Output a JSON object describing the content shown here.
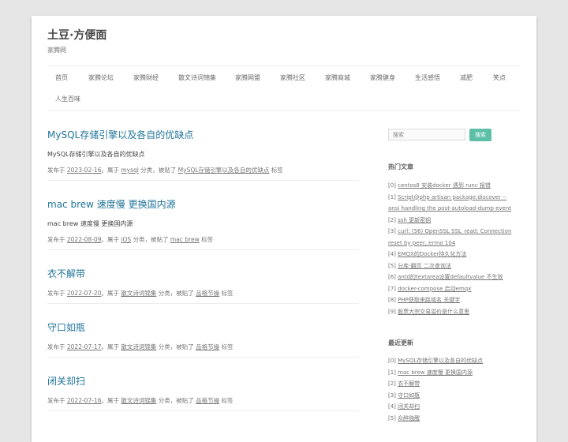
{
  "site": {
    "title": "土豆·方便面",
    "description": "家腾网"
  },
  "nav": [
    "首页",
    "家腾论坛",
    "家腾财经",
    "散文诗词锦集",
    "家腾网盟",
    "家腾社区",
    "家腾商城",
    "家腾健身",
    "生活感悟",
    "减肥",
    "笑点",
    "人生百味"
  ],
  "posts": [
    {
      "title": "MySQL存储引擎以及各自的优缺点",
      "excerpt": "MySQL存储引擎以及各自的优缺点",
      "meta_pre": "发布于 ",
      "date": "2023-02-16",
      "mid1": "。属于 ",
      "category": "mysql",
      "mid2": " 分类，被贴了 ",
      "tag": "MySQL存储引擎以及各自的优缺点",
      "post": " 标签"
    },
    {
      "title": "mac brew 速度慢 更换国内源",
      "excerpt": "mac brew 速度慢 更换国内源",
      "meta_pre": "发布于 ",
      "date": "2022-08-09",
      "mid1": "。属于 ",
      "category": "iOS",
      "mid2": " 分类，被贴了 ",
      "tag": "mac brew",
      "post": " 标签"
    },
    {
      "title": "衣不解带",
      "excerpt": "",
      "meta_pre": "发布于 ",
      "date": "2022-07-20",
      "mid1": "。属于 ",
      "category": "散文诗词锦集",
      "mid2": " 分类，被贴了 ",
      "tag": "品格节操",
      "post": " 标签"
    },
    {
      "title": "守口如瓶",
      "excerpt": "",
      "meta_pre": "发布于 ",
      "date": "2022-07-17",
      "mid1": "。属于 ",
      "category": "散文诗词锦集",
      "mid2": " 分类，被贴了 ",
      "tag": "品格节操",
      "post": " 标签"
    },
    {
      "title": "闭关却扫",
      "excerpt": "",
      "meta_pre": "发布于 ",
      "date": "2022-07-16",
      "mid1": "。属于 ",
      "category": "散文诗词锦集",
      "mid2": " 分类，被贴了 ",
      "tag": "品格节操",
      "post": " 标签"
    }
  ],
  "search": {
    "placeholder": "搜索",
    "button": "搜索"
  },
  "hot": {
    "title": "热门文章",
    "items": [
      {
        "idx": "[0] ",
        "text": "centos8 安装docker 遇到 runc 报错"
      },
      {
        "idx": "[1] ",
        "text": "Script@php artisan package:discover --ansi handling the post-autoload-dump event"
      },
      {
        "idx": "[2] ",
        "text": "ssh 更新密钥"
      },
      {
        "idx": "[3] ",
        "text": "curl: (56) OpenSSL SSL_read: Connection reset by peer, errno 104"
      },
      {
        "idx": "[4] ",
        "text": "EMQX的Docker持久化方法"
      },
      {
        "idx": "[5] ",
        "text": "分库-翻页 二次查询法"
      },
      {
        "idx": "[6] ",
        "text": "antd的textarea设置defaultvalue 不生效"
      },
      {
        "idx": "[7] ",
        "text": "docker-compose 启动emqx"
      },
      {
        "idx": "[8] ",
        "text": "PHP获取来路域名 关键字"
      },
      {
        "idx": "[9] ",
        "text": "股票大宗交易溢价是什么意思"
      }
    ]
  },
  "recent": {
    "title": "最近更新",
    "items": [
      {
        "idx": "[0] ",
        "text": "MySQL存储引擎以及各自的优缺点"
      },
      {
        "idx": "[1] ",
        "text": "mac brew 速度慢 更换国内源"
      },
      {
        "idx": "[2] ",
        "text": "衣不解带"
      },
      {
        "idx": "[3] ",
        "text": "守口如瓶"
      },
      {
        "idx": "[4] ",
        "text": "闭关却扫"
      },
      {
        "idx": "[5] ",
        "text": "众醉独醒"
      }
    ]
  }
}
